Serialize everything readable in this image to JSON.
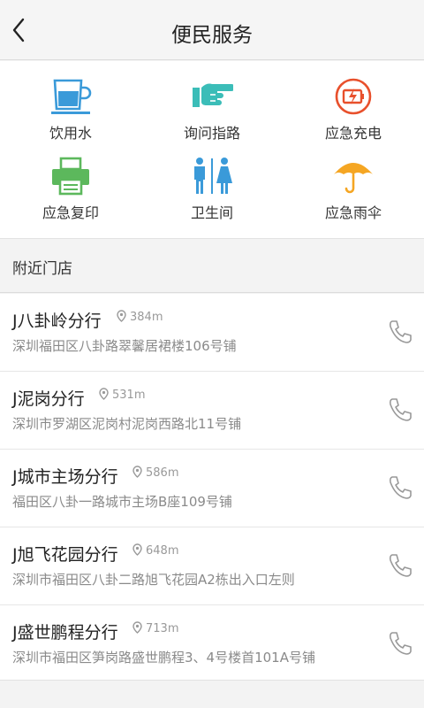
{
  "header": {
    "title": "便民服务"
  },
  "services": [
    {
      "label": "饮用水",
      "icon": "water-cup-icon"
    },
    {
      "label": "询问指路",
      "icon": "pointing-hand-icon"
    },
    {
      "label": "应急充电",
      "icon": "battery-charge-icon"
    },
    {
      "label": "应急复印",
      "icon": "printer-icon"
    },
    {
      "label": "卫生间",
      "icon": "restroom-icon"
    },
    {
      "label": "应急雨伞",
      "icon": "umbrella-icon"
    }
  ],
  "nearby": {
    "title": "附近门店"
  },
  "stores": [
    {
      "name": "J八卦岭分行",
      "distance": "384m",
      "address": "深圳福田区八卦路翠馨居裙楼106号铺"
    },
    {
      "name": "J泥岗分行",
      "distance": "531m",
      "address": "深圳市罗湖区泥岗村泥岗西路北11号铺"
    },
    {
      "name": "J城市主场分行",
      "distance": "586m",
      "address": "福田区八卦一路城市主场B座109号铺"
    },
    {
      "name": "J旭飞花园分行",
      "distance": "648m",
      "address": "深圳市福田区八卦二路旭飞花园A2栋出入口左则"
    },
    {
      "name": "J盛世鹏程分行",
      "distance": "713m",
      "address": "深圳市福田区笋岗路盛世鹏程3、4号楼首101A号铺"
    }
  ],
  "colors": {
    "blue": "#3a9ad9",
    "teal": "#3bbdb8",
    "red": "#e8502c",
    "green": "#5cb85c",
    "orange": "#f5a623"
  }
}
